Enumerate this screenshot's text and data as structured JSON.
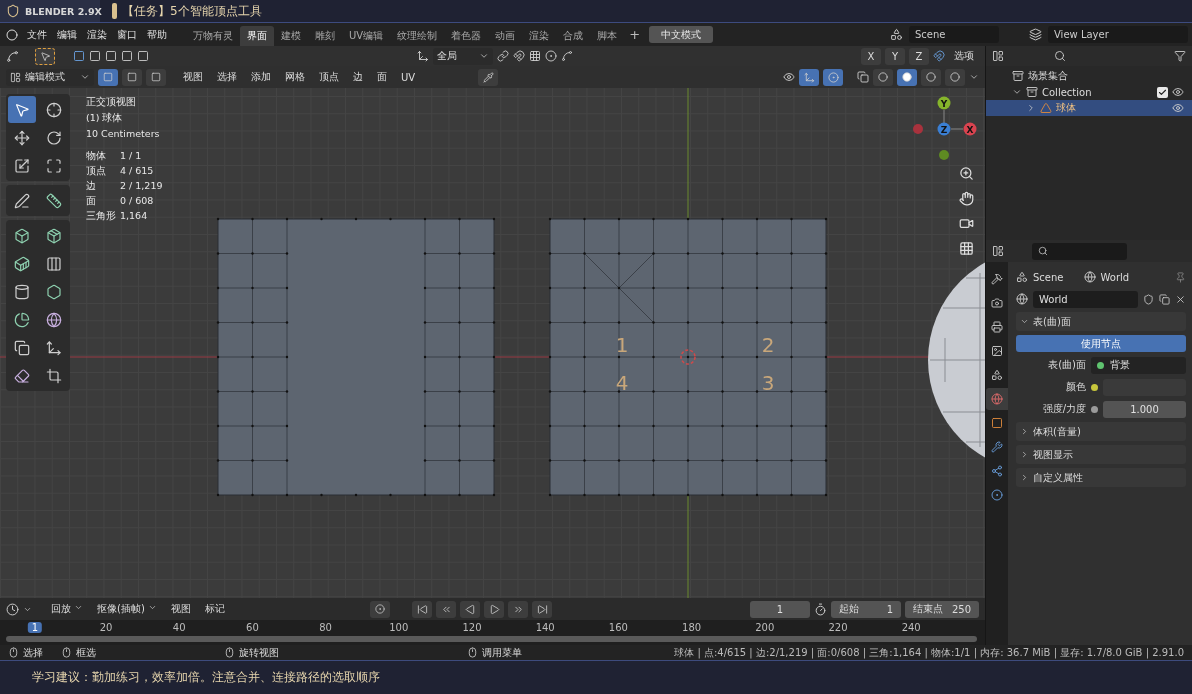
{
  "banner": {
    "logo": "BLENDER 2.9X",
    "title": "【任务】5个智能顶点工具"
  },
  "menu": [
    "文件",
    "编辑",
    "渲染",
    "窗口",
    "帮助"
  ],
  "workspaces": [
    {
      "label": "万物有灵",
      "selected": false
    },
    {
      "label": "界面",
      "selected": true
    },
    {
      "label": "建模",
      "selected": false
    },
    {
      "label": "雕刻",
      "selected": false
    },
    {
      "label": "UV编辑",
      "selected": false
    },
    {
      "label": "纹理绘制",
      "selected": false
    },
    {
      "label": "着色器",
      "selected": false
    },
    {
      "label": "动画",
      "selected": false
    },
    {
      "label": "渲染",
      "selected": false
    },
    {
      "label": "合成",
      "selected": false
    },
    {
      "label": "脚本",
      "selected": false
    }
  ],
  "add_workspace": "+",
  "mode_badge": "中文模式",
  "scene": "Scene",
  "view_layer": "View Layer",
  "tool_header": {
    "orientation": "全局",
    "axes": [
      "X",
      "Y",
      "Z"
    ],
    "options": "选项"
  },
  "mode_header": {
    "mode": "编辑模式",
    "select_modes": [
      {
        "selected": true
      },
      {
        "selected": false
      },
      {
        "selected": false
      }
    ],
    "menus": [
      "视图",
      "选择",
      "添加",
      "网格",
      "顶点",
      "边",
      "面",
      "UV"
    ],
    "shading": [
      {
        "selected": false
      },
      {
        "selected": true
      },
      {
        "selected": false
      },
      {
        "selected": false
      }
    ]
  },
  "viewport": {
    "view_name": "正交顶视图",
    "object": "(1) 球体",
    "scale": "10 Centimeters",
    "stats": [
      {
        "label": "物体",
        "value": "1 / 1"
      },
      {
        "label": "顶点",
        "value": "4 / 615"
      },
      {
        "label": "边",
        "value": "2 / 1,219"
      },
      {
        "label": "面",
        "value": "0 / 608"
      },
      {
        "label": "三角形",
        "value": "1,164"
      }
    ],
    "vertex_labels": [
      "1",
      "2",
      "4",
      "3"
    ],
    "gizmo": [
      "Y",
      "Z",
      "X"
    ],
    "tools": [
      {
        "selected": true
      },
      {
        "selected": false
      },
      {
        "selected": false
      },
      {
        "selected": false
      },
      {
        "selected": false
      },
      {
        "selected": false
      },
      {
        "selected": false
      },
      {
        "selected": false
      },
      {
        "selected": false
      },
      {
        "selected": false
      },
      {
        "selected": false
      },
      {
        "selected": false
      },
      {
        "selected": false
      },
      {
        "selected": false
      },
      {
        "selected": false
      },
      {
        "selected": false
      },
      {
        "selected": false
      },
      {
        "selected": false
      },
      {
        "selected": false
      },
      {
        "selected": false
      }
    ]
  },
  "outliner": {
    "items": [
      {
        "label": "场景集合",
        "selected": false,
        "children": [
          {
            "label": "Collection",
            "selected": false,
            "expanded": true,
            "checked": true,
            "children": [
              {
                "label": "球体",
                "selected": true,
                "expanded": false
              }
            ]
          }
        ]
      }
    ]
  },
  "properties": {
    "tabs": [
      {
        "selected": false
      },
      {
        "selected": false
      },
      {
        "selected": false
      },
      {
        "selected": false
      },
      {
        "selected": false
      },
      {
        "selected": true
      },
      {
        "selected": false
      },
      {
        "selected": false
      },
      {
        "selected": false
      },
      {
        "selected": false
      }
    ],
    "breadcrumb": [
      "Scene",
      "World"
    ],
    "world": "World",
    "surface_panel": {
      "title": "表(曲)面",
      "expanded": true,
      "use_nodes": {
        "label": "使用节点",
        "on": true
      },
      "rows": [
        {
          "kind": "link",
          "label": "表(曲)面",
          "value": "背景",
          "color": "#5fc36f"
        },
        {
          "kind": "color",
          "label": "颜色",
          "color": "#c7c63c"
        },
        {
          "kind": "number",
          "label": "强度/力度",
          "value": "1.000",
          "color": "#9a9a9a"
        }
      ]
    },
    "panels": [
      {
        "title": "体积(音量)",
        "expanded": false
      },
      {
        "title": "视图显示",
        "expanded": false
      },
      {
        "title": "自定义属性",
        "expanded": false
      }
    ]
  },
  "timeline": {
    "menus": [
      {
        "label": "回放",
        "dropdown": true
      },
      {
        "label": "抠像(插帧)",
        "dropdown": true
      },
      {
        "label": "视图",
        "dropdown": false
      },
      {
        "label": "标记",
        "dropdown": false
      }
    ],
    "current": "1",
    "start_label": "起始",
    "start": "1",
    "end_label": "结束点",
    "end": "250",
    "frames": [
      {
        "label": "1",
        "selected": true
      },
      {
        "label": "20",
        "selected": false
      },
      {
        "label": "40",
        "selected": false
      },
      {
        "label": "60",
        "selected": false
      },
      {
        "label": "80",
        "selected": false
      },
      {
        "label": "100",
        "selected": false
      },
      {
        "label": "120",
        "selected": false
      },
      {
        "label": "140",
        "selected": false
      },
      {
        "label": "160",
        "selected": false
      },
      {
        "label": "180",
        "selected": false
      },
      {
        "label": "200",
        "selected": false
      },
      {
        "label": "220",
        "selected": false
      },
      {
        "label": "240",
        "selected": false
      }
    ]
  },
  "status": {
    "hints": [
      "选择",
      "框选",
      "旋转视图",
      "调用菜单"
    ],
    "stats": "球体 | 点:4/615 | 边:2/1,219 | 面:0/608 | 三角:1,164 | 物体:1/1 | 内存: 36.7 MiB | 显存: 1.7/8.0 GiB | 2.91.0"
  },
  "caption": "学习建议：勤加练习，效率加倍。注意合并、连接路径的选取顺序"
}
